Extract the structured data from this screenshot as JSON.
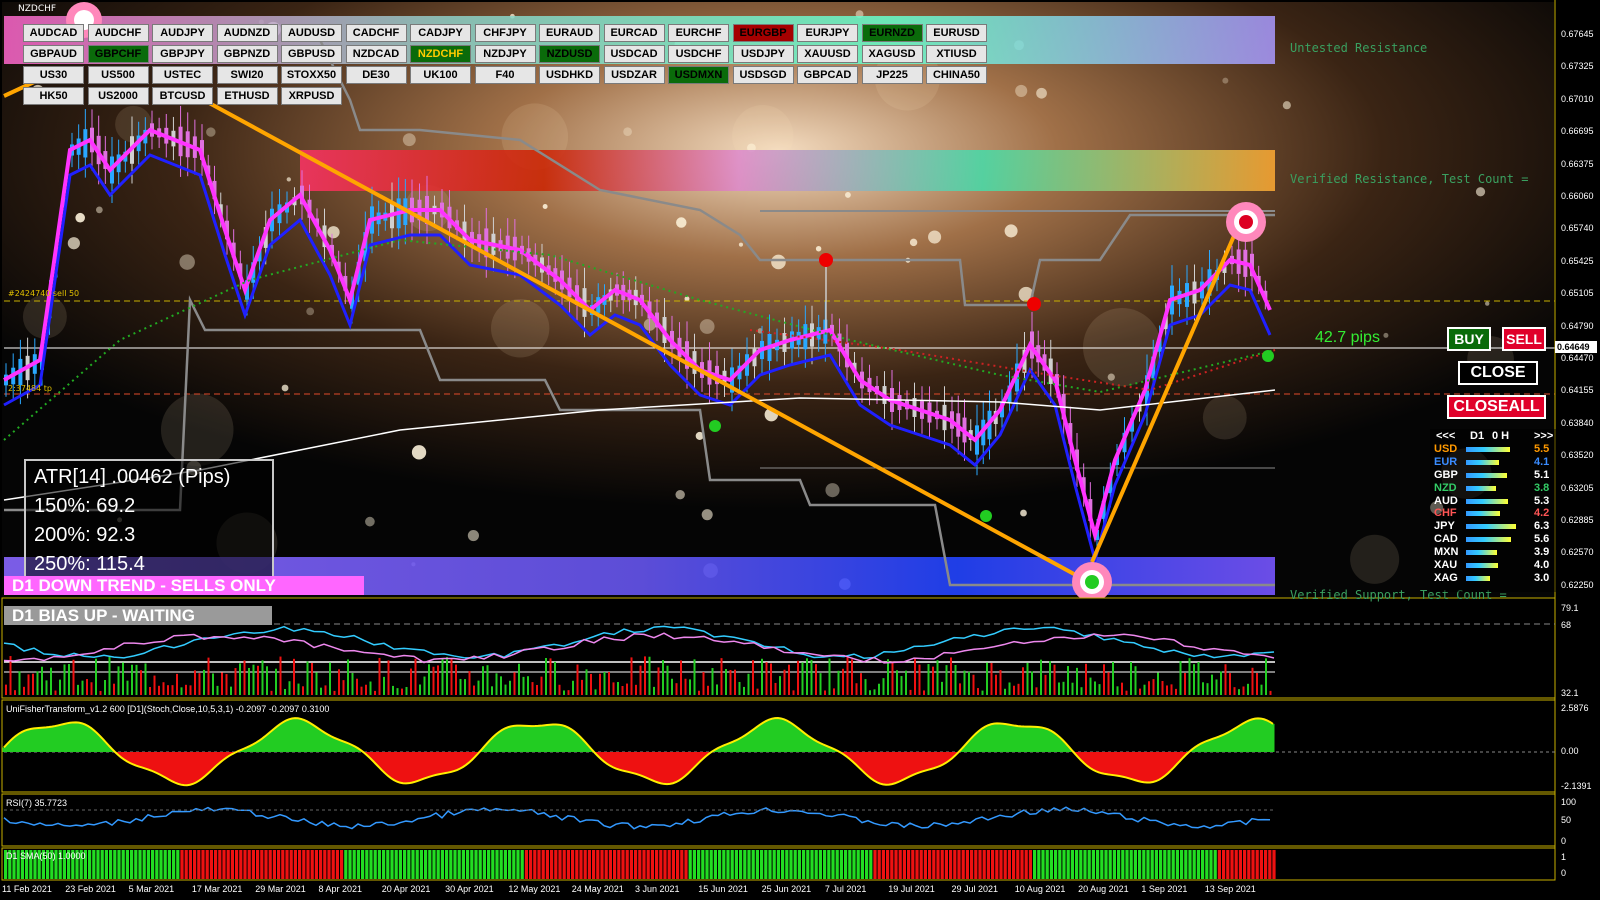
{
  "window": {
    "title": "NZDCHF"
  },
  "symbols": [
    {
      "label": "AUDCAD",
      "state": "normal"
    },
    {
      "label": "AUDCHF",
      "state": "normal"
    },
    {
      "label": "AUDJPY",
      "state": "normal"
    },
    {
      "label": "AUDNZD",
      "state": "normal"
    },
    {
      "label": "AUDUSD",
      "state": "normal"
    },
    {
      "label": "CADCHF",
      "state": "normal"
    },
    {
      "label": "CADJPY",
      "state": "normal"
    },
    {
      "label": "CHFJPY",
      "state": "normal"
    },
    {
      "label": "EURAUD",
      "state": "normal"
    },
    {
      "label": "EURCAD",
      "state": "normal"
    },
    {
      "label": "EURCHF",
      "state": "normal"
    },
    {
      "label": "EURGBP",
      "state": "red"
    },
    {
      "label": "EURJPY",
      "state": "normal"
    },
    {
      "label": "EURNZD",
      "state": "green"
    },
    {
      "label": "EURUSD",
      "state": "normal"
    },
    {
      "label": "GBPAUD",
      "state": "normal"
    },
    {
      "label": "GBPCHF",
      "state": "green"
    },
    {
      "label": "GBPJPY",
      "state": "normal"
    },
    {
      "label": "GBPNZD",
      "state": "normal"
    },
    {
      "label": "GBPUSD",
      "state": "normal"
    },
    {
      "label": "NZDCAD",
      "state": "normal"
    },
    {
      "label": "NZDCHF",
      "state": "selected"
    },
    {
      "label": "NZDJPY",
      "state": "normal"
    },
    {
      "label": "NZDUSD",
      "state": "green"
    },
    {
      "label": "USDCAD",
      "state": "normal"
    },
    {
      "label": "USDCHF",
      "state": "normal"
    },
    {
      "label": "USDJPY",
      "state": "normal"
    },
    {
      "label": "XAUUSD",
      "state": "normal"
    },
    {
      "label": "XAGUSD",
      "state": "normal"
    },
    {
      "label": "XTIUSD",
      "state": "normal"
    },
    {
      "label": "US30",
      "state": "normal"
    },
    {
      "label": "US500",
      "state": "normal"
    },
    {
      "label": "USTEC",
      "state": "normal"
    },
    {
      "label": "SWI20",
      "state": "normal"
    },
    {
      "label": "STOXX50",
      "state": "normal"
    },
    {
      "label": "DE30",
      "state": "normal"
    },
    {
      "label": "UK100",
      "state": "normal"
    },
    {
      "label": "F40",
      "state": "normal"
    },
    {
      "label": "USDHKD",
      "state": "normal"
    },
    {
      "label": "USDZAR",
      "state": "normal"
    },
    {
      "label": "USDMXN",
      "state": "green"
    },
    {
      "label": "USDSGD",
      "state": "normal"
    },
    {
      "label": "GBPCAD",
      "state": "normal"
    },
    {
      "label": "JP225",
      "state": "normal"
    },
    {
      "label": "CHINA50",
      "state": "normal"
    },
    {
      "label": "HK50",
      "state": "normal"
    },
    {
      "label": "US2000",
      "state": "normal"
    },
    {
      "label": "BTCUSD",
      "state": "normal"
    },
    {
      "label": "ETHUSD",
      "state": "normal"
    },
    {
      "label": "XRPUSD",
      "state": "normal"
    }
  ],
  "atr": {
    "line1": "ATR[14] .00462  (Pips)",
    "line2": "150%: 69.2",
    "line3": "200%: 92.3",
    "line4": "250%: 115.4"
  },
  "banners": {
    "trend": "D1  DOWN TREND - SELLS ONLY",
    "bias": "D1  BIAS UP - WAITING"
  },
  "zones": {
    "untested": "Untested Resistance",
    "verified_res": "Verified Resistance, Test Count =",
    "verified_sup": "Verified Support, Test Count ="
  },
  "pips": "42.7 pips",
  "line_labels": {
    "upper": "#2424740 sell 50",
    "lower": "2:37484 tp"
  },
  "trade_buttons": {
    "buy": "BUY",
    "sell": "SELL",
    "close": "CLOSE",
    "closeall": "CLOSEALL"
  },
  "strength": {
    "nav_prev": "<<<",
    "timeframe": "D1",
    "values": "0 H",
    "nav_next": ">>>",
    "rows": [
      {
        "cur": "USD",
        "val": "5.5",
        "color": "#ff9900",
        "fill": 0.55
      },
      {
        "cur": "EUR",
        "val": "4.1",
        "color": "#3a8cff",
        "fill": 0.41
      },
      {
        "cur": "GBP",
        "val": "5.1",
        "color": "#ffffff",
        "fill": 0.51
      },
      {
        "cur": "NZD",
        "val": "3.8",
        "color": "#33cc66",
        "fill": 0.38
      },
      {
        "cur": "AUD",
        "val": "5.3",
        "color": "#ffffff",
        "fill": 0.53
      },
      {
        "cur": "CHF",
        "val": "4.2",
        "color": "#ff5555",
        "fill": 0.42
      },
      {
        "cur": "JPY",
        "val": "6.3",
        "color": "#ffffff",
        "fill": 0.63
      },
      {
        "cur": "CAD",
        "val": "5.6",
        "color": "#ffffff",
        "fill": 0.56
      },
      {
        "cur": "MXN",
        "val": "3.9",
        "color": "#ffffff",
        "fill": 0.39
      },
      {
        "cur": "XAU",
        "val": "4.0",
        "color": "#ffffff",
        "fill": 0.4
      },
      {
        "cur": "XAG",
        "val": "3.0",
        "color": "#ffffff",
        "fill": 0.3
      }
    ]
  },
  "price_axis": [
    "0.67645",
    "0.67325",
    "0.67010",
    "0.66695",
    "0.66375",
    "0.66060",
    "0.65740",
    "0.65425",
    "0.65105",
    "0.64790",
    "0.64470",
    "0.64155",
    "0.63840",
    "0.63520",
    "0.63205",
    "0.62885",
    "0.62570",
    "0.62250"
  ],
  "current_price": "0.64649",
  "indicators": {
    "osc1_axis": [
      "79.1",
      "68",
      "32.1"
    ],
    "fisher_label": "UniFisherTransform_v1.2 600 [D1](Stoch,Close,10,5,3,1) -0.2097 -0.2097 0.3100",
    "fisher_axis": [
      "2.5876",
      "0.00",
      "-2.1391"
    ],
    "rsi_label": "RSI(7) 35.7723",
    "rsi_axis": [
      "100",
      "50",
      "0"
    ],
    "sma_label": "D1 SMA(50) 1.0000",
    "sma_axis": [
      "1",
      "0"
    ]
  },
  "dates": [
    "11 Feb 2021",
    "23 Feb 2021",
    "5 Mar 2021",
    "17 Mar 2021",
    "29 Mar 2021",
    "8 Apr 2021",
    "20 Apr 2021",
    "30 Apr 2021",
    "12 May 2021",
    "24 May 2021",
    "3 Jun 2021",
    "15 Jun 2021",
    "25 Jun 2021",
    "7 Jul 2021",
    "19 Jul 2021",
    "29 Jul 2021",
    "10 Aug 2021",
    "20 Aug 2021",
    "1 Sep 2021",
    "13 Sep 2021"
  ],
  "colors": {
    "bull": "#2aa8ff",
    "bear": "#e070e0",
    "neutral": "#d0d0d0",
    "ma_fast": "#ff33ff",
    "ma_slow": "#2020ff",
    "trend": "#ffa500",
    "hist_up": "#22cc22",
    "hist_down": "#ee1111"
  }
}
